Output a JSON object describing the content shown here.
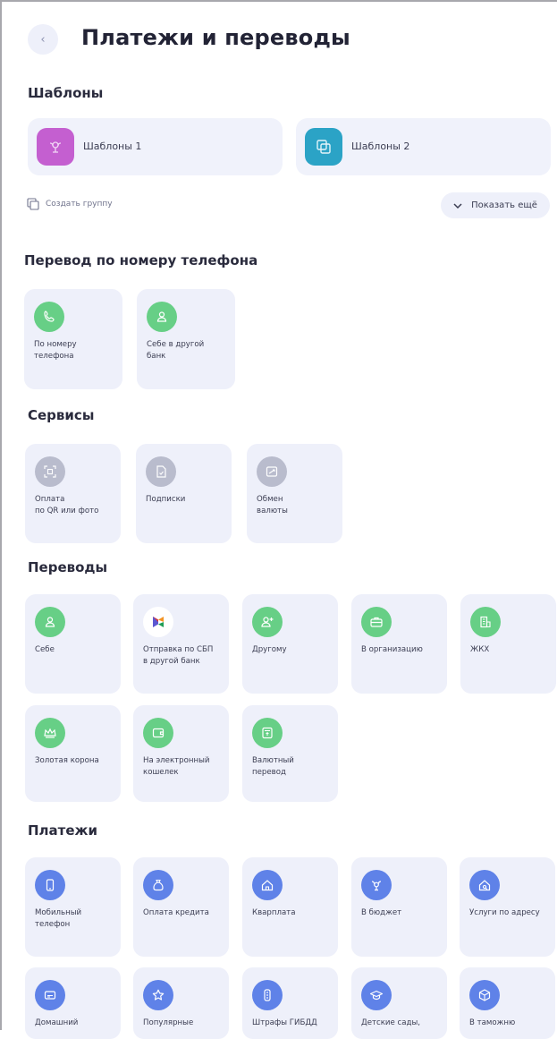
{
  "header": {
    "back_icon": "chevron-left-icon",
    "title": "Платежи и переводы"
  },
  "templates": {
    "heading": "Шаблоны",
    "items": [
      {
        "label": "Шаблоны 1",
        "icon": "template-flower-icon",
        "color": "#c45fd0"
      },
      {
        "label": "Шаблоны 2",
        "icon": "copy-icon",
        "color": "#2ba3c6"
      }
    ],
    "create_group": "Создать группу",
    "show_more": "Показать ещё"
  },
  "phone_transfer": {
    "heading": "Перевод по номеру телефона",
    "items": [
      {
        "label": "По номеру\nтелефона",
        "icon": "phone-icon"
      },
      {
        "label": "Себе в другой\nбанк",
        "icon": "person-icon"
      }
    ]
  },
  "services": {
    "heading": "Сервисы",
    "items": [
      {
        "label": "Оплата\nпо QR или фото",
        "icon": "qr-scan-icon"
      },
      {
        "label": "Подписки",
        "icon": "document-icon"
      },
      {
        "label": "Обмен\nвалюты",
        "icon": "currency-exchange-icon"
      }
    ]
  },
  "transfers": {
    "heading": "Переводы",
    "items": [
      {
        "label": "Себе",
        "icon": "person-icon"
      },
      {
        "label": "Отправка по СБП\nв другой банк",
        "icon": "sbp-logo-icon"
      },
      {
        "label": "Другому",
        "icon": "person-add-icon"
      },
      {
        "label": "В организацию",
        "icon": "briefcase-icon"
      },
      {
        "label": "ЖКХ",
        "icon": "building-icon"
      },
      {
        "label": "Золотая корона",
        "icon": "crown-icon"
      },
      {
        "label": "На электронный\nкошелек",
        "icon": "wallet-icon"
      },
      {
        "label": "Валютный\nперевод",
        "icon": "currency-doc-icon"
      }
    ]
  },
  "payments": {
    "heading": "Платежи",
    "items": [
      {
        "label": "Мобильный\nтелефон",
        "icon": "mobile-icon"
      },
      {
        "label": "Оплата кредита",
        "icon": "money-bag-icon"
      },
      {
        "label": "Кварплата",
        "icon": "house-icon"
      },
      {
        "label": "В бюджет",
        "icon": "emblem-icon"
      },
      {
        "label": "Услуги по адресу",
        "icon": "house-search-icon"
      },
      {
        "label": "Домашний",
        "icon": "router-icon"
      },
      {
        "label": "Популярные",
        "icon": "star-icon"
      },
      {
        "label": "Штрафы ГИБДД",
        "icon": "traffic-light-icon"
      },
      {
        "label": "Детские сады,",
        "icon": "graduation-cap-icon"
      },
      {
        "label": "В таможню",
        "icon": "package-icon"
      }
    ]
  }
}
